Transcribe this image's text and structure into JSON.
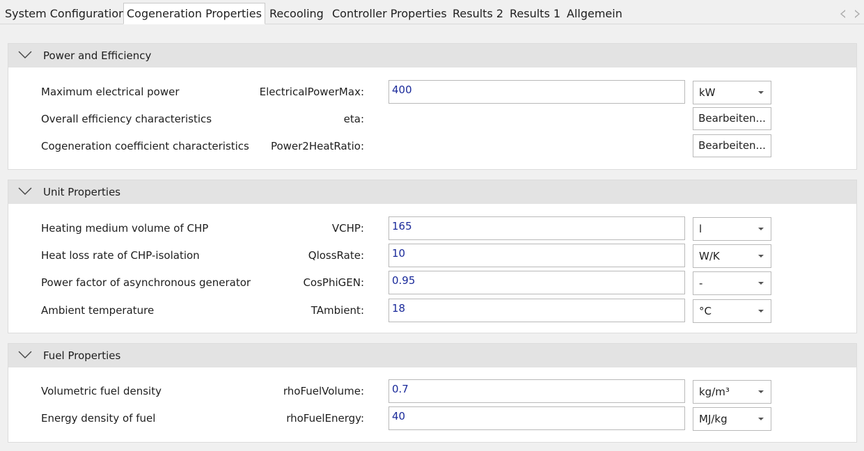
{
  "tabs": [
    {
      "label": "System Configuration",
      "active": false
    },
    {
      "label": "Cogeneration Properties",
      "active": true
    },
    {
      "label": "Recooling",
      "active": false
    },
    {
      "label": "Controller Properties",
      "active": false
    },
    {
      "label": "Results 2",
      "active": false
    },
    {
      "label": "Results 1",
      "active": false
    },
    {
      "label": "Allgemein",
      "active": false
    }
  ],
  "groups": [
    {
      "title": "Power and Efficiency",
      "rows": [
        {
          "label": "Maximum electrical power",
          "param": "ElectricalPowerMax:",
          "value": "400",
          "unit": "kW"
        },
        {
          "label": "Overall efficiency characteristics",
          "param": "eta:",
          "button": "Bearbeiten..."
        },
        {
          "label": "Cogeneration coefficient characteristics",
          "param": "Power2HeatRatio:",
          "button": "Bearbeiten..."
        }
      ]
    },
    {
      "title": "Unit Properties",
      "rows": [
        {
          "label": "Heating medium volume of CHP",
          "param": "VCHP:",
          "value": "165",
          "unit": "l"
        },
        {
          "label": "Heat loss rate of CHP-isolation",
          "param": "QlossRate:",
          "value": "10",
          "unit": "W/K"
        },
        {
          "label": "Power factor of asynchronous generator",
          "param": "CosPhiGEN:",
          "value": "0.95",
          "unit": "-"
        },
        {
          "label": "Ambient temperature",
          "param": "TAmbient:",
          "value": "18",
          "unit": "°C"
        }
      ]
    },
    {
      "title": "Fuel Properties",
      "rows": [
        {
          "label": "Volumetric fuel density",
          "param": "rhoFuelVolume:",
          "value": "0.7",
          "unit": "kg/m³"
        },
        {
          "label": "Energy density of fuel",
          "param": "rhoFuelEnergy:",
          "value": "40",
          "unit": "MJ/kg"
        }
      ]
    }
  ],
  "icons": {
    "collapse": "chevron-down-icon",
    "tab_scroll_left": "chevron-left-icon",
    "tab_scroll_right": "chevron-right-icon",
    "dropdown": "dropdown-arrow-icon"
  },
  "colors": {
    "value_text": "#1a2a9a",
    "group_header": "#e3e3e3",
    "background": "#f0f0f0"
  }
}
